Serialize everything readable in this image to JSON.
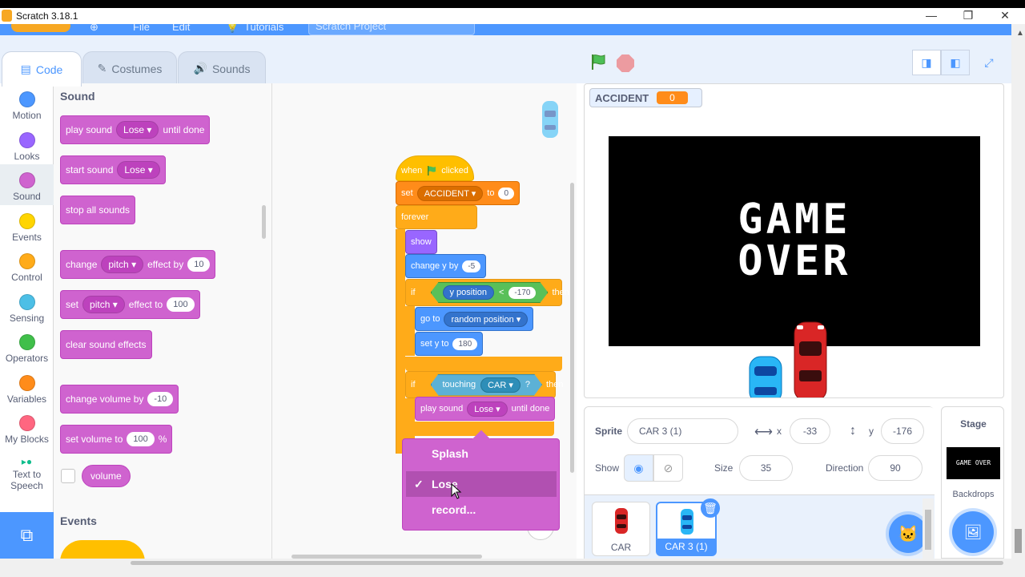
{
  "window": {
    "title": "Scratch 3.18.1",
    "minimize": "—",
    "maximize": "❐",
    "close": "✕"
  },
  "menubar": {
    "file": "File",
    "edit": "Edit",
    "tutorials": "Tutorials",
    "project_name": "Scratch Project"
  },
  "tabs": [
    {
      "label": "Code",
      "icon": "code-icon",
      "active": true
    },
    {
      "label": "Costumes",
      "icon": "brush-icon",
      "active": false
    },
    {
      "label": "Sounds",
      "icon": "speaker-icon",
      "active": false
    }
  ],
  "categories": [
    {
      "label": "Motion",
      "color": "#4c97ff"
    },
    {
      "label": "Looks",
      "color": "#9966ff"
    },
    {
      "label": "Sound",
      "color": "#cf63cf",
      "selected": true
    },
    {
      "label": "Events",
      "color": "#ffd500"
    },
    {
      "label": "Control",
      "color": "#ffab19"
    },
    {
      "label": "Sensing",
      "color": "#4cbfe6"
    },
    {
      "label": "Operators",
      "color": "#40bf4a"
    },
    {
      "label": "Variables",
      "color": "#ff8c1a"
    },
    {
      "label": "My Blocks",
      "color": "#ff6680"
    },
    {
      "label": "Text to Speech",
      "color": "#0fbd8c"
    }
  ],
  "palette": {
    "section": "Sound",
    "next_section": "Events",
    "blocks": {
      "play_sound": {
        "label": "play sound",
        "value": "Lose",
        "suffix": "until done"
      },
      "start_sound": {
        "label": "start sound",
        "value": "Lose"
      },
      "stop_all": {
        "label": "stop all sounds"
      },
      "change_pitch": {
        "label": "change",
        "value": "pitch",
        "mid": "effect by",
        "num": "10"
      },
      "set_pitch": {
        "label": "set",
        "value": "pitch",
        "mid": "effect to",
        "num": "100"
      },
      "clear_effects": {
        "label": "clear sound effects"
      },
      "change_volume": {
        "label": "change volume by",
        "num": "-10"
      },
      "set_volume": {
        "label": "set volume to",
        "num": "100",
        "suffix": "%"
      },
      "volume_reporter": {
        "label": "volume"
      }
    }
  },
  "script": {
    "when_flag": {
      "pre": "when",
      "post": "clicked"
    },
    "set_var": {
      "label": "set",
      "var": "ACCIDENT",
      "to": "to",
      "value": "0"
    },
    "forever": "forever",
    "show": "show",
    "change_y": {
      "label": "change y by",
      "value": "-5"
    },
    "if1": {
      "if": "if",
      "reporter": "y position",
      "op": "<",
      "value": "-170",
      "then": "then"
    },
    "goto": {
      "label": "go to",
      "value": "random position"
    },
    "set_y": {
      "label": "set y to",
      "value": "180"
    },
    "if2": {
      "if": "if",
      "label": "touching",
      "value": "CAR",
      "q": "?",
      "then": "then"
    },
    "play_sound": {
      "label": "play sound",
      "value": "Lose",
      "suffix": "until done"
    }
  },
  "sound_dropdown": {
    "options": [
      {
        "label": "Splash",
        "selected": false
      },
      {
        "label": "Lose",
        "selected": true
      },
      {
        "label": "record...",
        "selected": false
      }
    ]
  },
  "stage": {
    "monitor": {
      "name": "ACCIDENT",
      "value": "0"
    },
    "backdrop_text": [
      "GAME",
      "OVER"
    ],
    "colors": {
      "red_car": "#d92626",
      "blue_car": "#29b6f6"
    }
  },
  "sprite_info": {
    "sprite_label": "Sprite",
    "sprite_name": "CAR 3 (1)",
    "x_label": "x",
    "x": "-33",
    "y_label": "y",
    "y": "-176",
    "show_label": "Show",
    "size_label": "Size",
    "size": "35",
    "direction_label": "Direction",
    "direction": "90"
  },
  "sprites": [
    {
      "name": "CAR",
      "selected": false
    },
    {
      "name": "CAR 3 (1)",
      "selected": true
    }
  ],
  "stage_pane": {
    "title": "Stage",
    "backdrops_label": "Backdrops",
    "thumb_text": "GAME OVER"
  }
}
